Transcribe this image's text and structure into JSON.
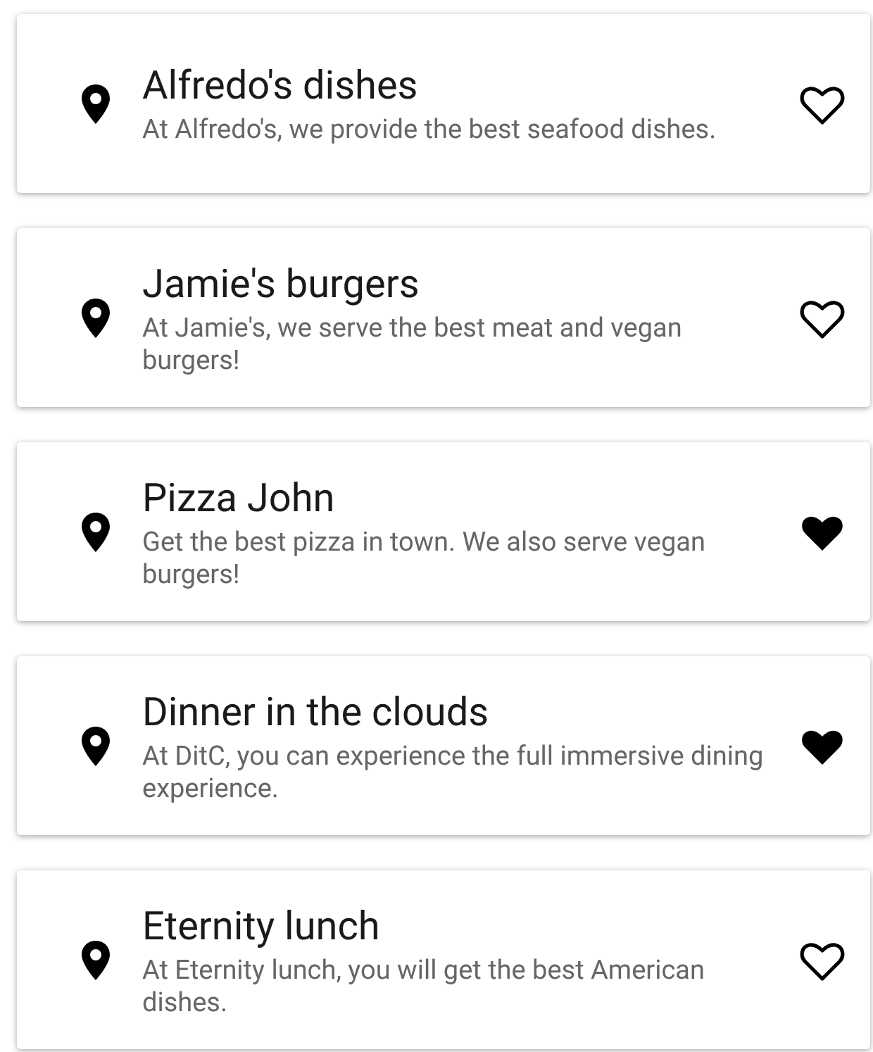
{
  "restaurants": [
    {
      "name": "Alfredo's dishes",
      "description": "At Alfredo's, we provide the best seafood dishes.",
      "favorite": false
    },
    {
      "name": "Jamie's burgers",
      "description": "At Jamie's, we serve the best meat and vegan burgers!",
      "favorite": false
    },
    {
      "name": "Pizza John",
      "description": "Get the best pizza in town. We also serve vegan burgers!",
      "favorite": true
    },
    {
      "name": "Dinner in the clouds",
      "description": "At DitC, you can experience the full immersive dining experience.",
      "favorite": true
    },
    {
      "name": "Eternity lunch",
      "description": "At Eternity lunch, you will get the best American dishes.",
      "favorite": false
    }
  ]
}
